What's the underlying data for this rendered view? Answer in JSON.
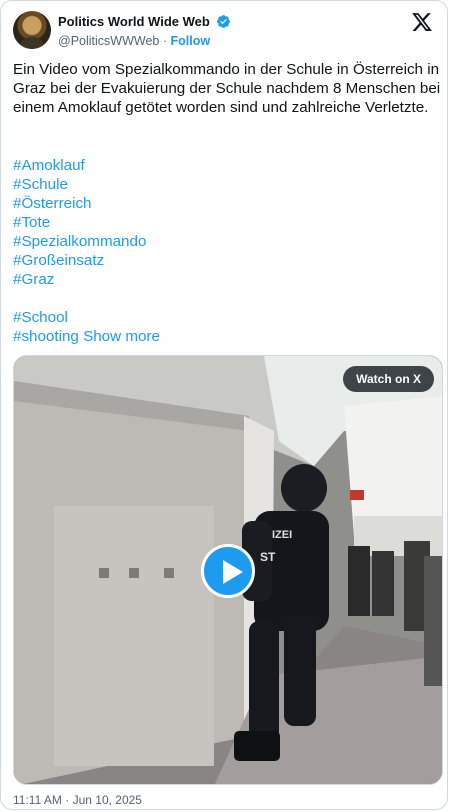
{
  "author": {
    "display_name": "Politics World Wide Web",
    "handle": "@PoliticsWWWeb",
    "separator": "·",
    "follow_label": "Follow"
  },
  "icons": {
    "avatar": "avatar-image",
    "verified": "verified-badge-icon",
    "platform": "x-logo-icon",
    "play": "play-icon"
  },
  "tweet": {
    "text": "Ein Video vom Spezialkommando in der Schule in Österreich in Graz bei der Evakuierung der Schule nachdem 8 Menschen bei einem Amoklauf getötet worden sind und zahlreiche Verletzte.",
    "hashtags_group1": [
      "#Amoklauf",
      "#Schule",
      "#Österreich",
      "#Tote",
      "#Spezialkommando",
      "#Großeinsatz",
      "#Graz"
    ],
    "hashtags_group2": [
      "#School"
    ],
    "last_hashtag": "#shooting",
    "show_more_label": "Show more"
  },
  "video": {
    "watch_label": "Watch on X",
    "vest_text": "IZEI",
    "vest_text2": "ST"
  },
  "timestamp": "11:11 AM · Jun 10, 2025",
  "colors": {
    "accent": "#1d9bf0",
    "text": "#0f1419",
    "secondary_text": "#536471",
    "border": "#cfd9de"
  }
}
